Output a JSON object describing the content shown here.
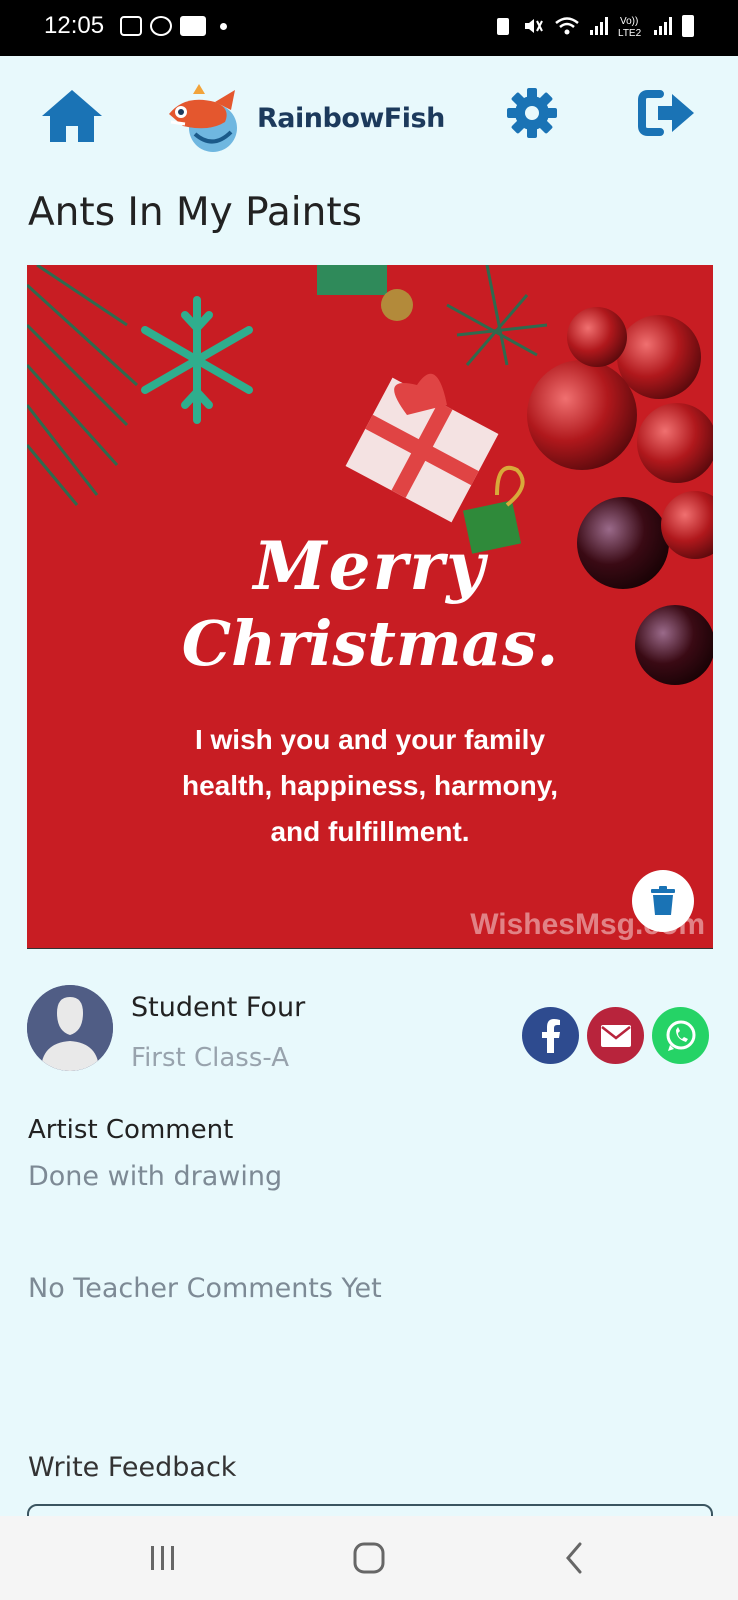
{
  "status_bar": {
    "time": "12:05",
    "left_icons": [
      "gallery-icon",
      "whatsapp-icon",
      "paytm-icon"
    ],
    "right_icons": [
      "battery-saver-icon",
      "mute-icon",
      "wifi-icon",
      "signal-icon",
      "volte-icon",
      "battery-icon"
    ],
    "volte_label": "Vo))\nLTE2"
  },
  "header": {
    "brand_name": "RainbowFish",
    "icons": [
      "home-icon",
      "settings-icon",
      "logout-icon"
    ],
    "accent_color": "#1a73b5"
  },
  "artwork": {
    "title": "Ants In My Paints",
    "heading_line1": "Merry",
    "heading_line2": "Christmas.",
    "message_line1": "I wish you and your family",
    "message_line2": "health, happiness, harmony,",
    "message_line3": "and fulfillment.",
    "watermark": "WishesMsg.com",
    "background_color": "#c81d23"
  },
  "artist": {
    "name": "Student Four",
    "class": "First Class-A"
  },
  "share": {
    "icons": [
      "facebook-icon",
      "email-icon",
      "whatsapp-icon"
    ],
    "colors": {
      "facebook": "#2e4b8f",
      "email": "#b8243c",
      "whatsapp": "#25d366"
    }
  },
  "comments": {
    "artist_comment_label": "Artist Comment",
    "artist_comment_text": "Done with drawing",
    "teacher_comments": "No Teacher Comments Yet",
    "feedback_label": "Write Feedback",
    "feedback_value": ""
  },
  "nav": {
    "icons": [
      "recent-apps-icon",
      "home-nav-icon",
      "back-icon"
    ]
  }
}
